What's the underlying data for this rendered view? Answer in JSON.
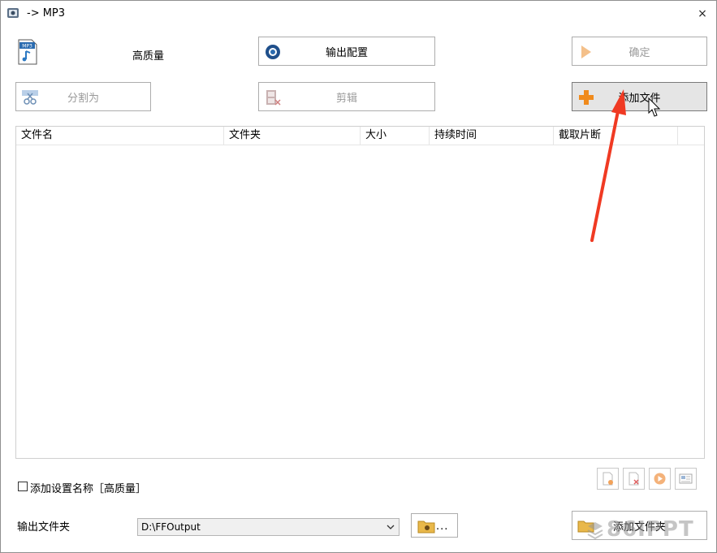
{
  "window": {
    "title": "-> MP3",
    "close_label": "×"
  },
  "toolbar": {
    "quality_label": "高质量",
    "output_config_label": "输出配置",
    "ok_label": "确定",
    "split_label": "分割为",
    "edit_label": "剪辑",
    "add_file_label": "添加文件"
  },
  "file_list": {
    "columns": [
      "文件名",
      "文件夹",
      "大小",
      "持续时间",
      "截取片断"
    ],
    "rows": []
  },
  "options": {
    "add_name_label": "添加设置名称［高质量］",
    "add_name_checked": false
  },
  "output": {
    "folder_label": "输出文件夹",
    "folder_value": "D:\\FFOutput",
    "browse_dots": "..."
  },
  "bottom": {
    "add_folder_label": "添加文件夹"
  },
  "watermark": {
    "text": "86IPPT"
  },
  "colors": {
    "annotation_arrow": "#f03a23",
    "plus_icon": "#f08a1c"
  }
}
